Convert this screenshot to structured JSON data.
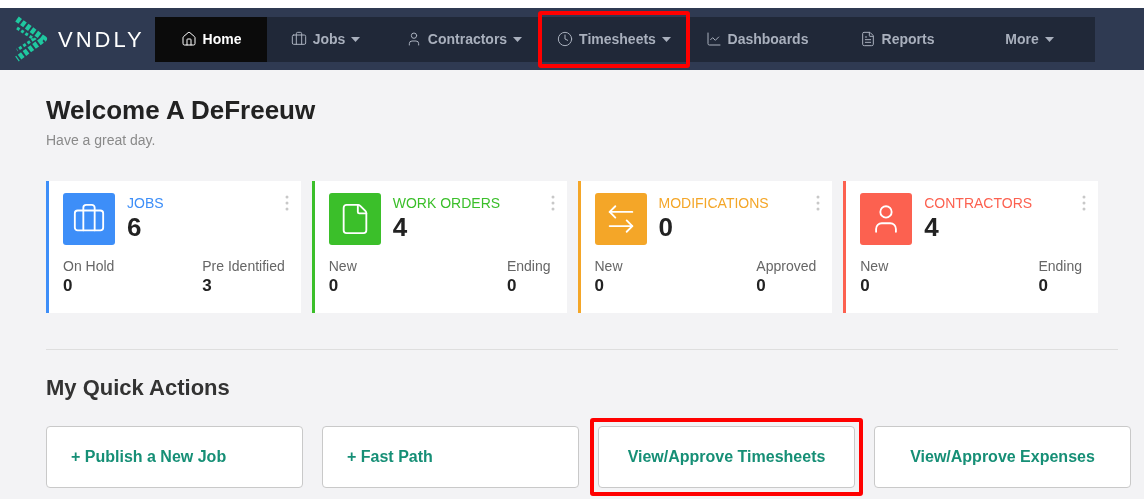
{
  "brand": {
    "name": "VNDLY"
  },
  "nav": [
    {
      "label": "Home",
      "kind": "home",
      "selected": true,
      "dropdown": false,
      "highlighted": false
    },
    {
      "label": "Jobs",
      "kind": "jobs",
      "selected": false,
      "dropdown": true,
      "highlighted": false
    },
    {
      "label": "Contractors",
      "kind": "contractors",
      "selected": false,
      "dropdown": true,
      "highlighted": false
    },
    {
      "label": "Timesheets",
      "kind": "timesheets",
      "selected": false,
      "dropdown": true,
      "highlighted": true
    },
    {
      "label": "Dashboards",
      "kind": "dashboards",
      "selected": false,
      "dropdown": false,
      "highlighted": false
    },
    {
      "label": "Reports",
      "kind": "reports",
      "selected": false,
      "dropdown": false,
      "highlighted": false
    },
    {
      "label": "More",
      "kind": "more",
      "selected": false,
      "dropdown": true,
      "highlighted": false
    }
  ],
  "welcome": {
    "title": "Welcome A DeFreeuw",
    "subtitle": "Have a great day."
  },
  "cards": [
    {
      "kind": "jobs",
      "title": "JOBS",
      "count": "6",
      "color": "#3d8ef8",
      "stats": [
        {
          "label": "On Hold",
          "value": "0"
        },
        {
          "label": "Pre Identified",
          "value": "3"
        }
      ]
    },
    {
      "kind": "work_orders",
      "title": "WORK ORDERS",
      "count": "4",
      "color": "#3bbf2a",
      "stats": [
        {
          "label": "New",
          "value": "0"
        },
        {
          "label": "Ending",
          "value": "0"
        }
      ]
    },
    {
      "kind": "modifications",
      "title": "MODIFICATIONS",
      "count": "0",
      "color": "#f4a628",
      "stats": [
        {
          "label": "New",
          "value": "0"
        },
        {
          "label": "Approved",
          "value": "0"
        }
      ]
    },
    {
      "kind": "contractors",
      "title": "CONTRACTORS",
      "count": "4",
      "color": "#fc6150",
      "stats": [
        {
          "label": "New",
          "value": "0"
        },
        {
          "label": "Ending",
          "value": "0"
        }
      ]
    }
  ],
  "quick_actions": {
    "title": "My Quick Actions",
    "items": [
      {
        "label": "+ Publish a New Job",
        "highlighted": false
      },
      {
        "label": "+ Fast Path",
        "highlighted": false
      },
      {
        "label": "View/Approve Timesheets",
        "highlighted": true
      },
      {
        "label": "View/Approve Expenses",
        "highlighted": false
      }
    ]
  }
}
